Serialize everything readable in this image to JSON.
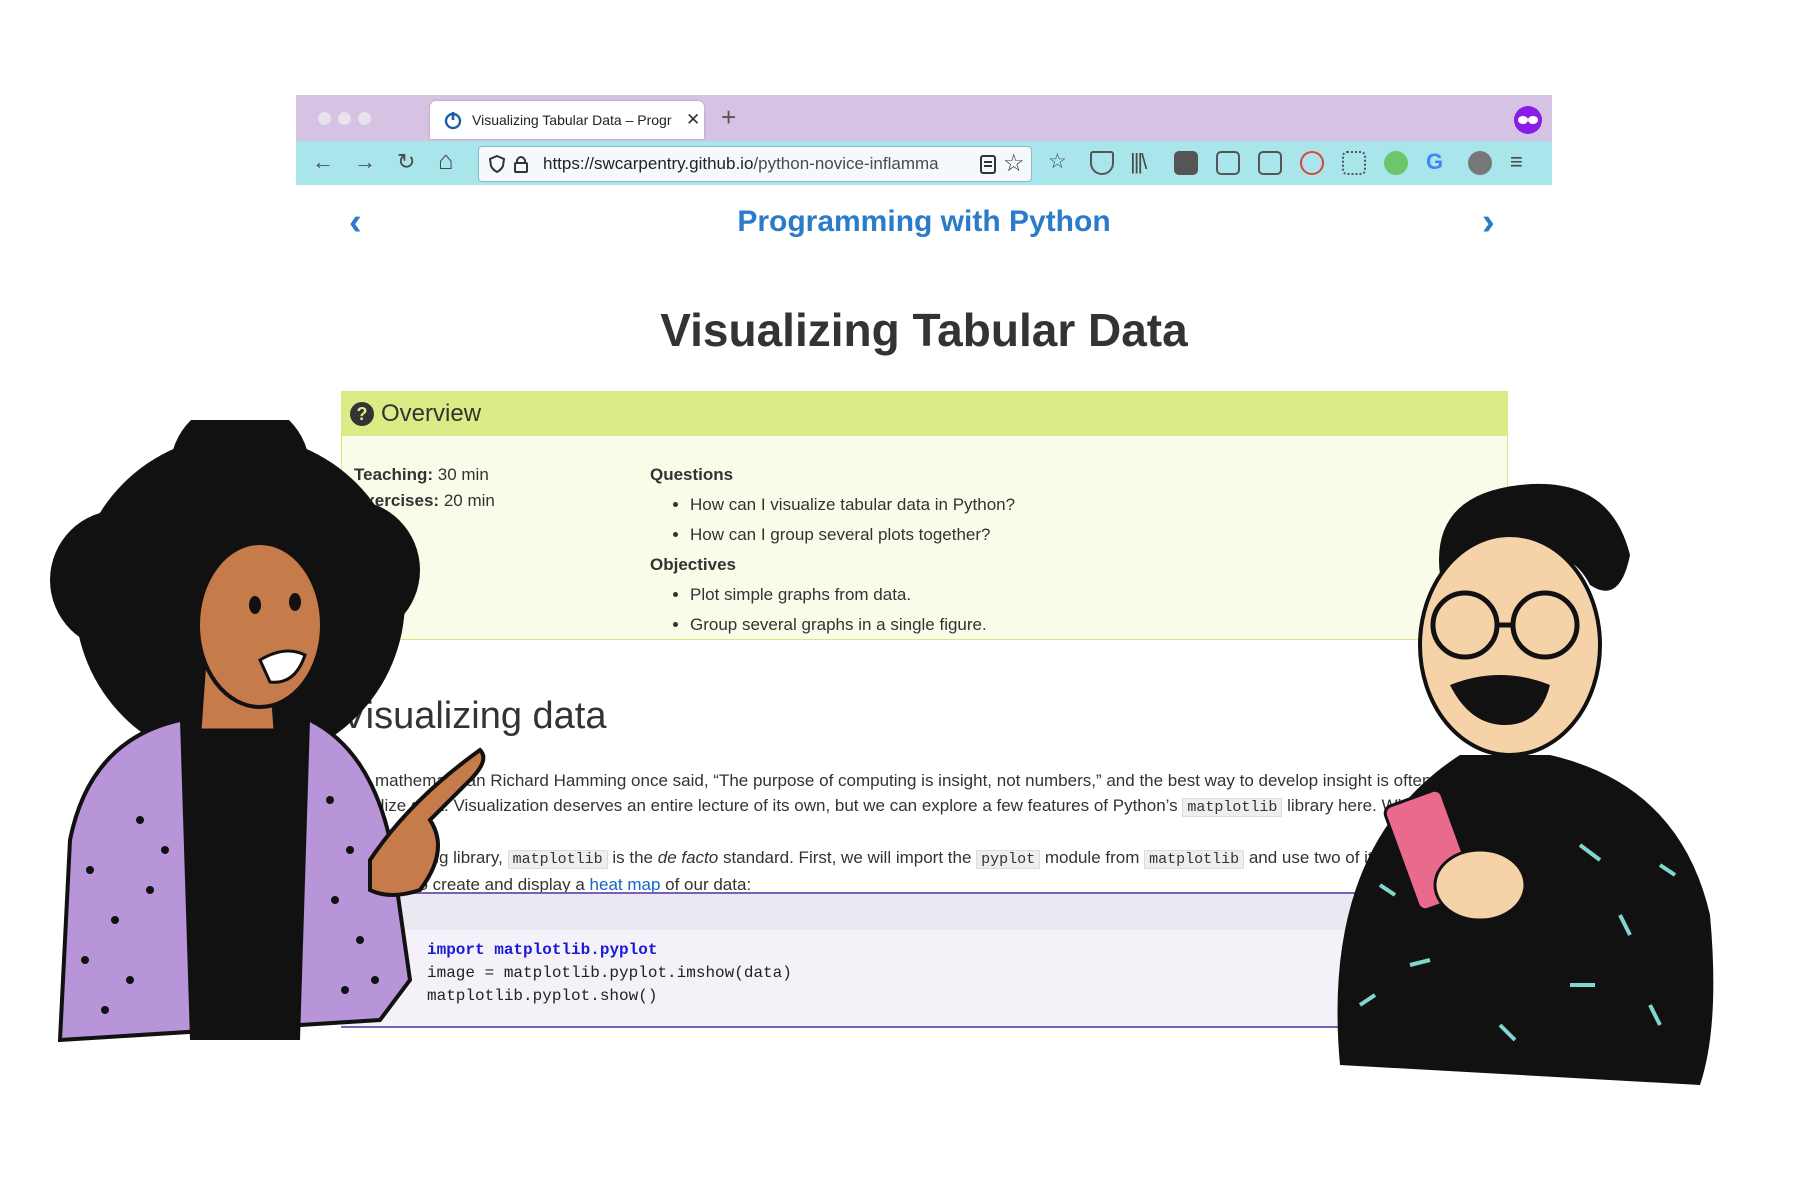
{
  "browser": {
    "tab_title": "Visualizing Tabular Data – Progr",
    "new_tab": "+",
    "url_host": "https://swcarpentry.github.io",
    "url_path": "/python-novice-inflamma",
    "buttons": {
      "back": "←",
      "forward": "→",
      "reload": "↻",
      "home": "⌂"
    }
  },
  "site": {
    "title": "Programming with Python",
    "prev": "‹",
    "next": "›"
  },
  "lesson": {
    "title": "Visualizing Tabular Data",
    "overview": {
      "heading": "Overview",
      "teaching_label": "Teaching:",
      "teaching_value": "30 min",
      "exercises_label": "Exercises:",
      "exercises_value": "20 min",
      "questions_label": "Questions",
      "questions": [
        "How can I visualize tabular data in Python?",
        "How can I group several plots together?"
      ],
      "objectives_label": "Objectives",
      "objectives": [
        "Plot simple graphs from data.",
        "Group several graphs in a single figure."
      ]
    },
    "section_heading": "Visualizing data",
    "para": {
      "l1a": "The mathematician Richard Hamming once said, “The purpose of computing is insight, not numbers,” and the best way to develop insight is often to",
      "l2a": "visualize data. Visualization deserves an entire lecture of its own, but we can explore a few features of Python’s ",
      "l2code": "matplotlib",
      "l2b": " library here. While there is no",
      "l3a": "official plotting library, ",
      "l3code": "matplotlib",
      "l3b": " is the ",
      "l3em": "de facto",
      "l3c": " standard. First, we will import the ",
      "l3code2": "pyplot",
      "l3d": " module from ",
      "l3code3": "matplotlib",
      "l3e": " and use two of its",
      "l4a": "functions to create and display a ",
      "l4link": "heat map",
      "l4b": " of our data:"
    },
    "code": {
      "line1_kw": "import",
      "line1_mod": "matplotlib.pyplot",
      "line2": "image = matplotlib.pyplot.imshow(data)",
      "line3": "matplotlib.pyplot.show()"
    }
  }
}
